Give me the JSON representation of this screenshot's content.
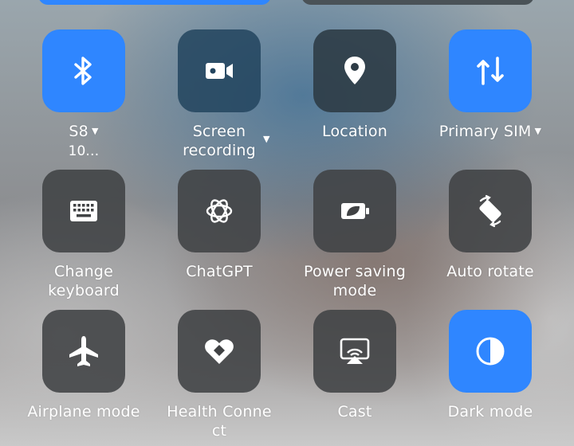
{
  "tiles": [
    {
      "label": "S8",
      "sublabel": "10…",
      "icon": "bluetooth-icon",
      "active": true,
      "dropdown": true
    },
    {
      "label": "Screen recording",
      "icon": "video-camera-icon",
      "active": false,
      "dropdown": true
    },
    {
      "label": "Location",
      "icon": "location-pin-icon",
      "active": false,
      "dropdown": false
    },
    {
      "label": "Primary SIM",
      "icon": "mobile-data-arrows-icon",
      "active": true,
      "dropdown": true
    },
    {
      "label": "Change keyboard",
      "icon": "keyboard-icon",
      "active": false,
      "dropdown": false
    },
    {
      "label": "ChatGPT",
      "icon": "chatgpt-logo-icon",
      "active": false,
      "dropdown": false
    },
    {
      "label": "Power saving mode",
      "icon": "battery-leaf-icon",
      "active": false,
      "dropdown": false
    },
    {
      "label": "Auto rotate",
      "icon": "auto-rotate-icon",
      "active": false,
      "dropdown": false
    },
    {
      "label": "Airplane mode",
      "icon": "airplane-icon",
      "active": false,
      "dropdown": false
    },
    {
      "label": "Health Conne ct",
      "icon": "health-connect-icon",
      "active": false,
      "dropdown": false
    },
    {
      "label": "Cast",
      "icon": "cast-icon",
      "active": false,
      "dropdown": false
    },
    {
      "label": "Dark mode",
      "icon": "dark-mode-icon",
      "active": true,
      "dropdown": false
    }
  ],
  "labels_display": {
    "screen_recording_line1": "Screen",
    "screen_recording_line2": "recording",
    "change_keyboard_line1": "Change",
    "change_keyboard_line2": "keyboard",
    "power_saving_line1": "Power saving",
    "power_saving_line2": "mode",
    "health_connect_line1": "Health Conne",
    "health_connect_line2": "ct"
  },
  "colors": {
    "active_tile": "#2f86ff",
    "inactive_tile": "#404244",
    "label_text": "#ffffff"
  }
}
